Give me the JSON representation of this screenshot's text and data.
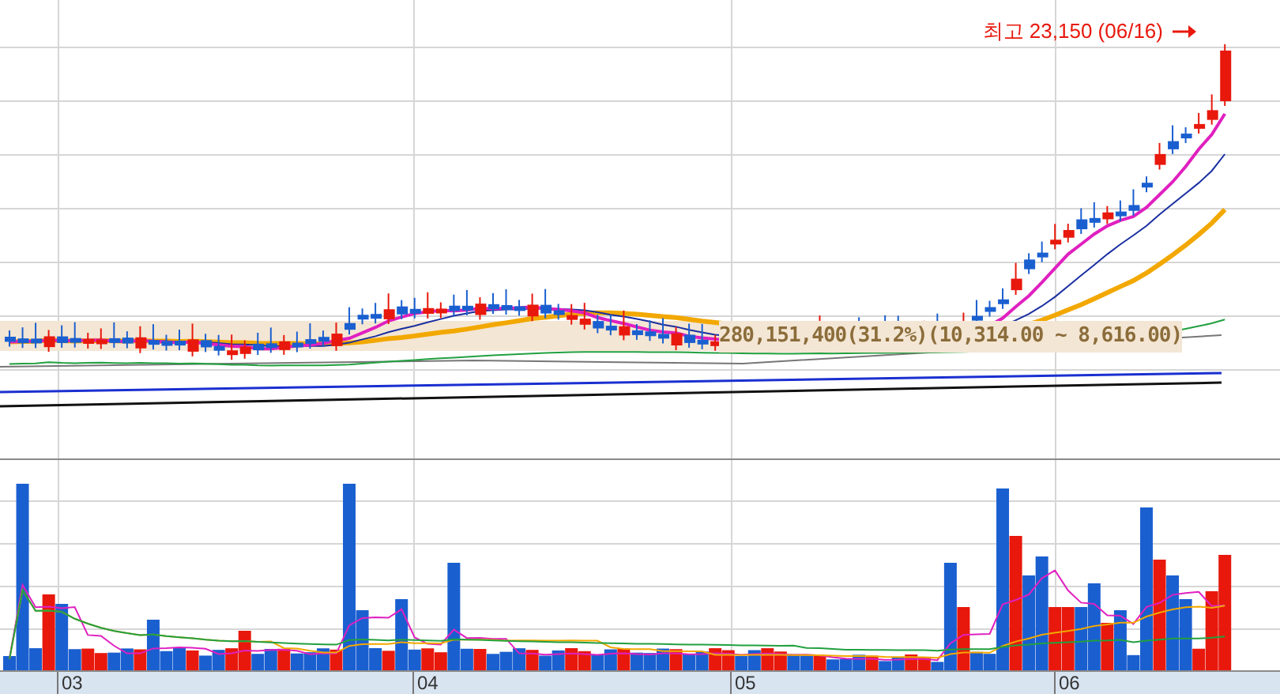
{
  "price_pane": {
    "high_label": "최고 23,150 (06/16)",
    "range_label": "280,151,400(31.2%)(10,314.00 ~ 8,616.00)"
  },
  "x_axis": {
    "labels": [
      "03",
      "04",
      "05",
      "06"
    ]
  }
}
